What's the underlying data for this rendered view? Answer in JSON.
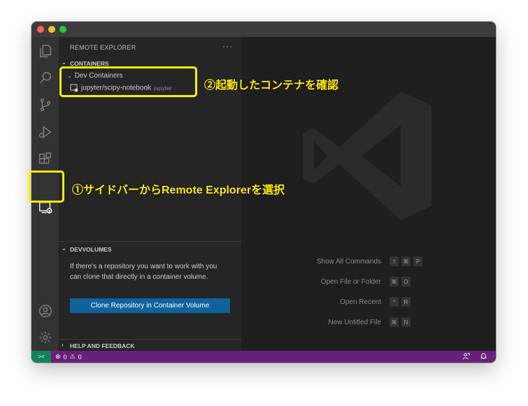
{
  "sidebar": {
    "title": "REMOTE EXPLORER",
    "more": "···",
    "containers_header": "CONTAINERS",
    "dev_containers_group": "Dev Containers",
    "container_name": "jupyter/scipy-notebook",
    "container_tag": "jupyter",
    "devvolumes_header": "DEVVOLUMES",
    "devvolumes_text": "If there's a repository you want to work with you can clone that directly in a container volume.",
    "clone_button": "Clone Repository in Container Volume",
    "help_header": "HELP AND FEEDBACK"
  },
  "editor": {
    "shortcuts": [
      {
        "label": "Show All Commands",
        "keys": [
          "⇧",
          "⌘",
          "P"
        ]
      },
      {
        "label": "Open File or Folder",
        "keys": [
          "⌘",
          "O"
        ]
      },
      {
        "label": "Open Recent",
        "keys": [
          "^",
          "R"
        ]
      },
      {
        "label": "New Untitled File",
        "keys": [
          "⌘",
          "N"
        ]
      }
    ]
  },
  "statusbar": {
    "remote_icon": "><",
    "errors": "0",
    "warnings": "0"
  },
  "annotations": {
    "step1": "①サイドバーからRemote Explorerを選択",
    "step2": "②起動したコンテナを確認"
  },
  "colors": {
    "statusbar": "#68217a",
    "remote_indicator": "#16825d",
    "button": "#0e639c",
    "callout": "#ffee00"
  }
}
